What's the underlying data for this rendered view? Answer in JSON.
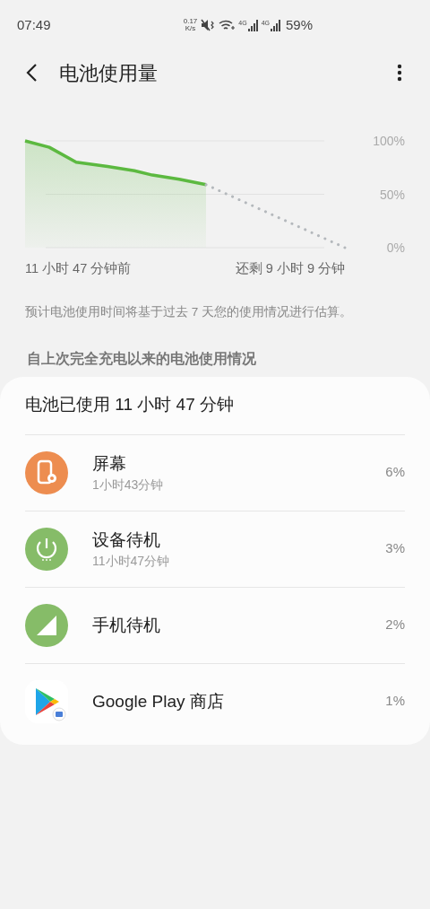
{
  "status_bar": {
    "time": "07:49",
    "net_speed": [
      "0.17",
      "K/s"
    ],
    "signal_labels": [
      "4G",
      "4G"
    ],
    "battery": "59%"
  },
  "header": {
    "title": "电池使用量"
  },
  "chart_level_labels": [
    "100%",
    "50%",
    "0%"
  ],
  "chart_time_labels": {
    "start": "11 小时 47 分钟前",
    "end": "还剩 9 小时 9 分钟"
  },
  "note": "预计电池使用时间将基于过去 7 天您的使用情况进行估算。",
  "section_title": "自上次完全充电以来的电池使用情况",
  "usage": {
    "title": "电池已使用 11 小时 47 分钟",
    "items": [
      {
        "kind": "screen",
        "color": "#ed8d50",
        "name": "屏幕",
        "duration": "1小时43分钟",
        "percent": "6%"
      },
      {
        "kind": "power",
        "color": "#86bc68",
        "name": "设备待机",
        "duration": "11小时47分钟",
        "percent": "3%"
      },
      {
        "kind": "signal",
        "color": "#86bc68",
        "name": "手机待机",
        "percent": "2%"
      },
      {
        "kind": "play",
        "name": "Google Play 商店",
        "percent": "1%"
      }
    ]
  }
}
